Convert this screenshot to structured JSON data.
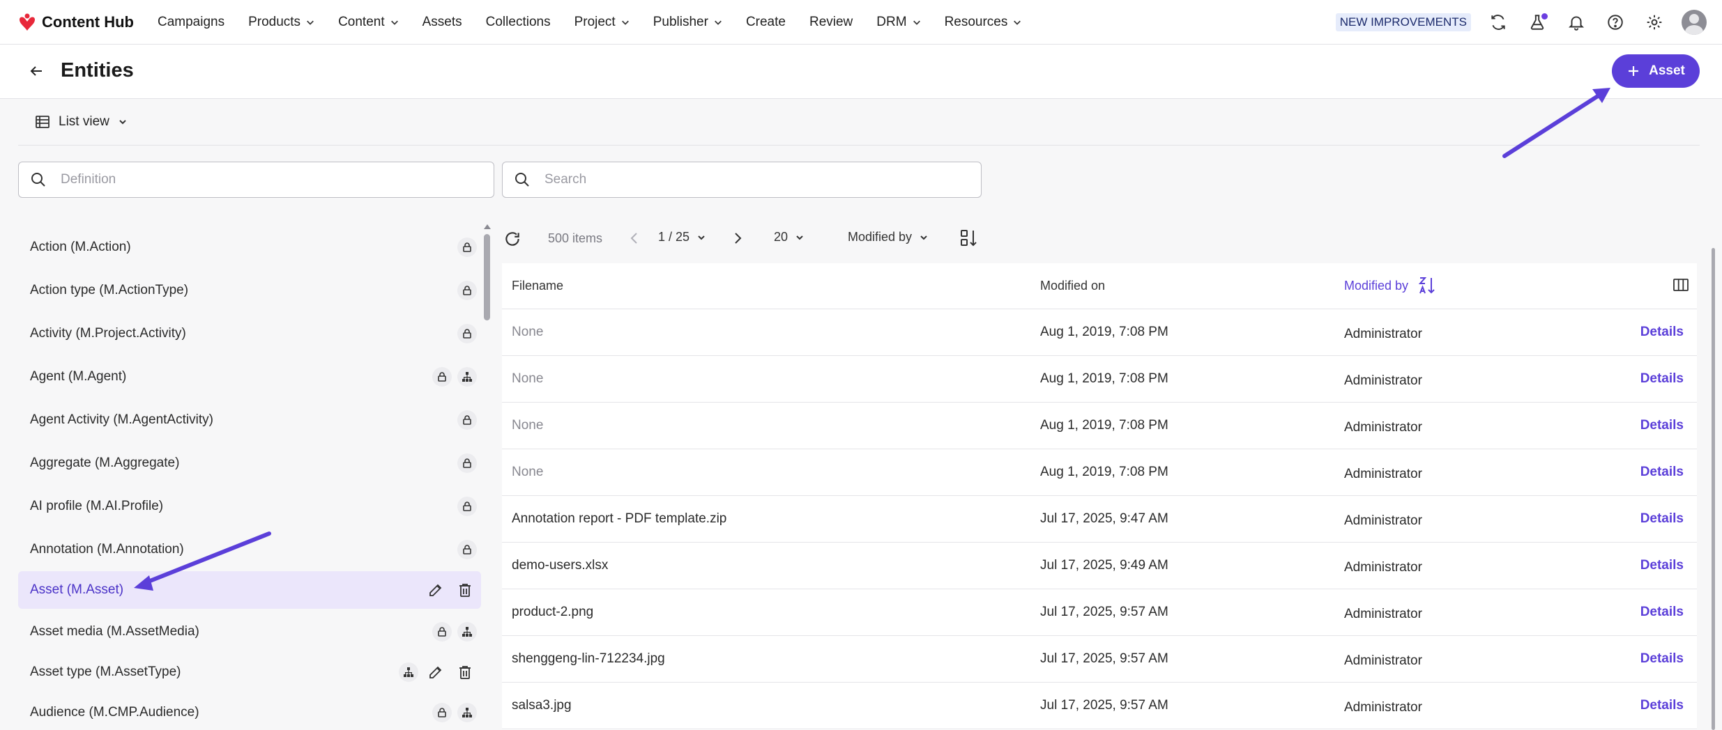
{
  "app": {
    "brand": "Content Hub",
    "nav": [
      {
        "label": "Campaigns",
        "dropdown": false
      },
      {
        "label": "Products",
        "dropdown": true
      },
      {
        "label": "Content",
        "dropdown": true
      },
      {
        "label": "Assets",
        "dropdown": false
      },
      {
        "label": "Collections",
        "dropdown": false
      },
      {
        "label": "Project",
        "dropdown": true
      },
      {
        "label": "Publisher",
        "dropdown": true
      },
      {
        "label": "Create",
        "dropdown": false
      },
      {
        "label": "Review",
        "dropdown": false
      },
      {
        "label": "DRM",
        "dropdown": true
      },
      {
        "label": "Resources",
        "dropdown": true
      }
    ],
    "new_improvements": "NEW IMPROVEMENTS",
    "icons": [
      "sync-icon",
      "flask-icon",
      "bell-icon",
      "help-icon",
      "gear-icon",
      "avatar"
    ]
  },
  "header": {
    "title": "Entities",
    "add_button_label": "Asset"
  },
  "view": {
    "label": "List view"
  },
  "search": {
    "definition_placeholder": "Definition",
    "search_placeholder": "Search"
  },
  "definitions": [
    {
      "label": "Action (M.Action)",
      "icons": [
        "lock"
      ]
    },
    {
      "label": "Action type (M.ActionType)",
      "icons": [
        "lock"
      ]
    },
    {
      "label": "Activity (M.Project.Activity)",
      "icons": [
        "lock"
      ]
    },
    {
      "label": "Agent (M.Agent)",
      "icons": [
        "lock",
        "taxonomy"
      ]
    },
    {
      "label": "Agent Activity (M.AgentActivity)",
      "icons": [
        "lock"
      ]
    },
    {
      "label": "Aggregate (M.Aggregate)",
      "icons": [
        "lock"
      ]
    },
    {
      "label": "AI profile (M.AI.Profile)",
      "icons": [
        "lock"
      ]
    },
    {
      "label": "Annotation (M.Annotation)",
      "icons": [
        "lock"
      ]
    },
    {
      "label": "Asset (M.Asset)",
      "icons": [
        "edit",
        "delete"
      ],
      "selected": true
    },
    {
      "label": "Asset media (M.AssetMedia)",
      "icons": [
        "lock",
        "taxonomy"
      ]
    },
    {
      "label": "Asset type (M.AssetType)",
      "icons": [
        "taxonomy",
        "edit",
        "delete"
      ]
    },
    {
      "label": "Audience (M.CMP.Audience)",
      "icons": [
        "lock",
        "taxonomy"
      ]
    }
  ],
  "toolbar": {
    "item_count": "500 items",
    "page": "1 / 25",
    "page_size": "20",
    "sort_by": "Modified by"
  },
  "table": {
    "columns": [
      "Filename",
      "Modified on",
      "Modified by"
    ],
    "rows": [
      {
        "filename": "None",
        "modified_on": "Aug 1, 2019, 7:08 PM",
        "modified_by": "Administrator",
        "action": "Details",
        "muted": true
      },
      {
        "filename": "None",
        "modified_on": "Aug 1, 2019, 7:08 PM",
        "modified_by": "Administrator",
        "action": "Details",
        "muted": true
      },
      {
        "filename": "None",
        "modified_on": "Aug 1, 2019, 7:08 PM",
        "modified_by": "Administrator",
        "action": "Details",
        "muted": true
      },
      {
        "filename": "None",
        "modified_on": "Aug 1, 2019, 7:08 PM",
        "modified_by": "Administrator",
        "action": "Details",
        "muted": true
      },
      {
        "filename": "Annotation report - PDF template.zip",
        "modified_on": "Jul 17, 2025, 9:47 AM",
        "modified_by": "Administrator",
        "action": "Details"
      },
      {
        "filename": "demo-users.xlsx",
        "modified_on": "Jul 17, 2025, 9:49 AM",
        "modified_by": "Administrator",
        "action": "Details"
      },
      {
        "filename": "product-2.png",
        "modified_on": "Jul 17, 2025, 9:57 AM",
        "modified_by": "Administrator",
        "action": "Details"
      },
      {
        "filename": "shenggeng-lin-712234.jpg",
        "modified_on": "Jul 17, 2025, 9:57 AM",
        "modified_by": "Administrator",
        "action": "Details"
      },
      {
        "filename": "salsa3.jpg",
        "modified_on": "Jul 17, 2025, 9:57 AM",
        "modified_by": "Administrator",
        "action": "Details"
      }
    ]
  },
  "colors": {
    "accent": "#5b3fd9",
    "brand_red": "#e8283a",
    "selected_bg": "#ebe6fb",
    "annotation_arrow": "#5b3fd9"
  }
}
